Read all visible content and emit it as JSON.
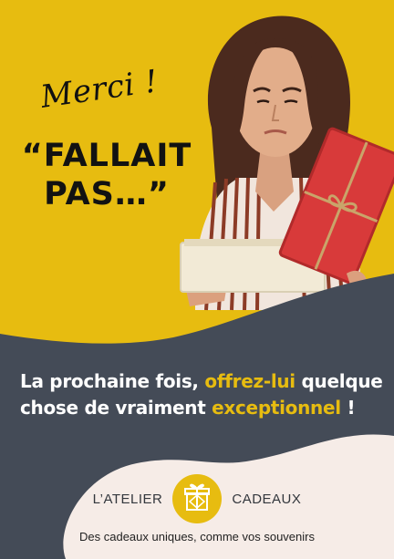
{
  "poster": {
    "merci": "Merci !",
    "quote_line1": "“FALLAIT",
    "quote_line2": "PAS…”",
    "headline_part1": "La prochaine fois, ",
    "headline_highlight1": "offrez-lui",
    "headline_part2": " quelque chose de vraiment ",
    "headline_highlight2": "exceptionnel",
    "headline_part3": " !",
    "brand_left": "L’ATELIER",
    "brand_right": "CADEAUX",
    "tagline": "Des cadeaux uniques, comme vos souvenirs"
  },
  "colors": {
    "yellow": "#e7bc10",
    "slate": "#444b57",
    "cream": "#f6ece7",
    "box_red": "#d83a3a",
    "text_dark": "#121212"
  },
  "illustration": "woman-opening-gift-box-photo"
}
